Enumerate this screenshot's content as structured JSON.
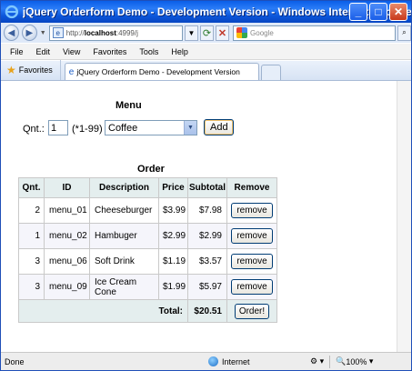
{
  "window": {
    "title": "jQuery Orderform Demo - Development Version - Windows Internet Explorer",
    "controls": {
      "minimize": "_",
      "maximize": "□",
      "close": "✕"
    }
  },
  "toolbar": {
    "back_icon": "back-arrow-icon",
    "forward_icon": "forward-arrow-icon",
    "address_prefix": "http://",
    "address_host": "localhost",
    "address_rest": ":4999/j",
    "search_placeholder": "Google"
  },
  "menubar": {
    "items": [
      "File",
      "Edit",
      "View",
      "Favorites",
      "Tools",
      "Help"
    ]
  },
  "tabs": {
    "favorites_label": "Favorites",
    "active_tab": "jQuery Orderform Demo - Development Version"
  },
  "page": {
    "menu_title": "Menu",
    "qnt_label": "Qnt.:",
    "qnt_value": "1",
    "qnt_hint": "(*1-99)",
    "product_selected": "Coffee",
    "add_label": "Add",
    "order_title": "Order",
    "table": {
      "headers": {
        "qnt": "Qnt.",
        "id": "ID",
        "description": "Description",
        "price": "Price",
        "subtotal": "Subtotal",
        "remove": "Remove"
      },
      "rows": [
        {
          "qnt": "2",
          "id": "menu_01",
          "description": "Cheeseburger",
          "price": "$3.99",
          "subtotal": "$7.98",
          "remove": "remove"
        },
        {
          "qnt": "1",
          "id": "menu_02",
          "description": "Hambuger",
          "price": "$2.99",
          "subtotal": "$2.99",
          "remove": "remove"
        },
        {
          "qnt": "3",
          "id": "menu_06",
          "description": "Soft Drink",
          "price": "$1.19",
          "subtotal": "$3.57",
          "remove": "remove"
        },
        {
          "qnt": "3",
          "id": "menu_09",
          "description": "Ice Cream Cone",
          "price": "$1.99",
          "subtotal": "$5.97",
          "remove": "remove"
        }
      ],
      "total_label": "Total:",
      "total_value": "$20.51",
      "order_button": "Order!"
    }
  },
  "statusbar": {
    "status_text": "Done",
    "zone": "Internet",
    "zoom": "100%"
  }
}
